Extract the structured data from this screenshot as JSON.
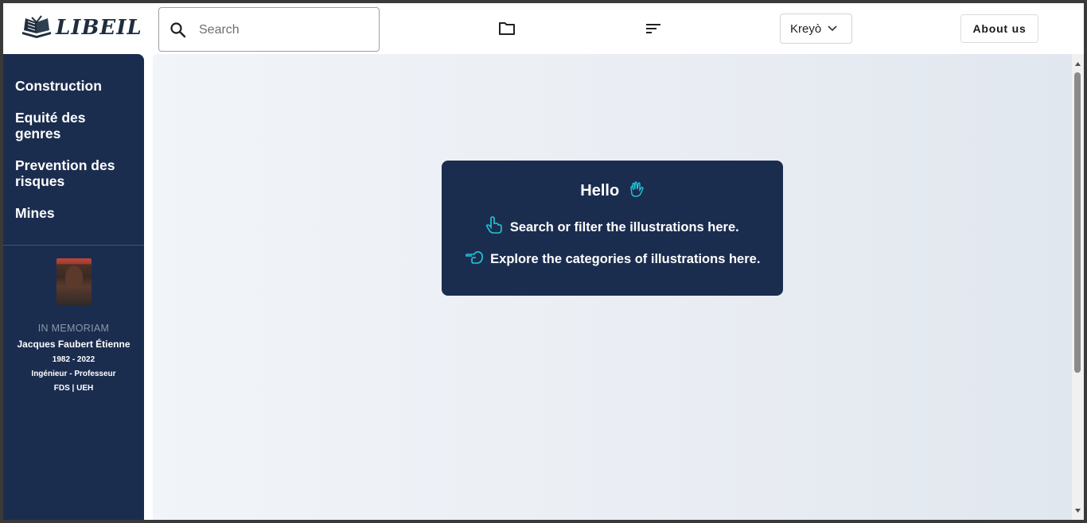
{
  "header": {
    "logo_text": "LIBEIL",
    "search_placeholder": "Search",
    "language": "Kreyò",
    "about_label": "About us"
  },
  "sidebar": {
    "items": [
      {
        "label": "Construction"
      },
      {
        "label": "Equité des genres"
      },
      {
        "label": "Prevention des risques"
      },
      {
        "label": "Mines"
      }
    ],
    "memoriam": {
      "label": "IN MEMORIAM",
      "name": "Jacques Faubert Étienne",
      "years": "1982 - 2022",
      "title": "Ingénieur - Professeur",
      "org": "FDS | UEH"
    }
  },
  "main": {
    "card": {
      "hello": "Hello",
      "line1": "Search or filter the illustrations here.",
      "line2": "Explore the categories of illustrations here."
    }
  },
  "colors": {
    "navy": "#1b2d4f",
    "accent": "#22c7d9",
    "background": "#eef1f6"
  },
  "icons": [
    "book-logo-icon",
    "search-icon",
    "folder-icon",
    "sort-icon",
    "chevron-down-icon",
    "waving-hand-icon",
    "pointing-up-icon",
    "pointing-left-icon"
  ]
}
